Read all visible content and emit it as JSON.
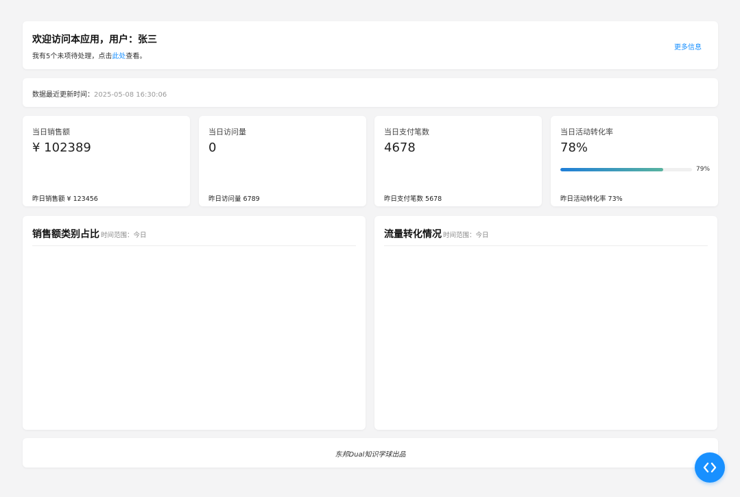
{
  "header": {
    "title": "欢迎访问本应用，用户：张三",
    "subtitle_prefix": "我有5个未项待处理，点击",
    "subtitle_link": "此处",
    "subtitle_suffix": "查看。",
    "more_label": "更多信息"
  },
  "update_bar": {
    "label": "数据最近更新时间：",
    "timestamp": "2025-05-08 16:30:06"
  },
  "stats": [
    {
      "label": "当日销售额",
      "value": "¥ 102389",
      "footer": "昨日销售额 ¥ 123456"
    },
    {
      "label": "当日访问量",
      "value": "0",
      "footer": "昨日访问量 6789"
    },
    {
      "label": "当日支付笔数",
      "value": "4678",
      "footer": "昨日支付笔数 5678"
    },
    {
      "label": "当日活动转化率",
      "value": "78%",
      "footer": "昨日活动转化率 73%",
      "progress": 78,
      "progress_text": "79%"
    }
  ],
  "panels": {
    "sales": {
      "title": "销售额类别占比",
      "range": "时间范围：今日"
    },
    "traffic": {
      "title": "流量转化情况",
      "range": "时间范围：今日"
    }
  },
  "footer": {
    "text": "东邦Dual知识学球出品"
  },
  "colors": {
    "accent": "#1890ff",
    "progress_start": "#1f7ed8",
    "progress_end": "#58b39f"
  },
  "icons": {
    "code_toggle": "code-brackets-icon"
  }
}
